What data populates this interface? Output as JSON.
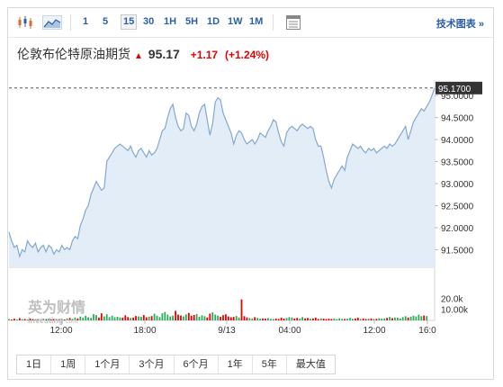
{
  "toolbar": {
    "candle_icon": "candlestick-icon",
    "area_icon": "area-chart-icon",
    "intervals": [
      "1",
      "5",
      "15",
      "30",
      "1H",
      "5H",
      "1D",
      "1W",
      "1M"
    ],
    "active_interval": "15",
    "table_icon": "table-icon",
    "tech_chart_link": "技术图表 »"
  },
  "header": {
    "name": "伦敦布伦特原油期货",
    "price": "95.17",
    "change": "+1.17",
    "change_pct": "(+1.24%)"
  },
  "colors": {
    "up": "#e60000",
    "down": "#2eaa5b",
    "line": "#84a8cf",
    "fill": "#e3edf7",
    "link": "#2a5ea8"
  },
  "chart_data": {
    "type": "area",
    "y_ticks": [
      "95.0000",
      "94.5000",
      "94.0000",
      "93.5000",
      "93.0000",
      "92.5000",
      "92.0000",
      "91.5000"
    ],
    "ylim": [
      91.1,
      95.35
    ],
    "current_label": "95.1700",
    "x_ticks": [
      "12:00",
      "18:00",
      "9/13",
      "04:00",
      "12:00",
      "16:0"
    ],
    "prices": [
      91.9,
      91.7,
      91.55,
      91.6,
      91.35,
      91.5,
      91.45,
      91.7,
      91.6,
      91.55,
      91.65,
      91.45,
      91.55,
      91.6,
      91.45,
      91.6,
      91.55,
      91.4,
      91.5,
      91.45,
      91.6,
      91.5,
      91.55,
      91.5,
      91.7,
      91.8,
      91.75,
      92.05,
      92.2,
      92.4,
      92.5,
      92.75,
      92.9,
      93.05,
      92.95,
      92.85,
      92.9,
      93.5,
      93.6,
      93.7,
      93.8,
      93.85,
      93.9,
      93.85,
      93.8,
      93.75,
      93.85,
      93.7,
      93.6,
      93.75,
      93.8,
      93.7,
      93.6,
      93.75,
      93.65,
      93.7,
      93.8,
      94.0,
      94.2,
      94.25,
      94.5,
      94.7,
      94.8,
      94.5,
      94.3,
      94.2,
      94.25,
      94.6,
      94.55,
      94.3,
      94.2,
      94.35,
      94.6,
      94.75,
      94.8,
      94.45,
      94.1,
      94.35,
      94.85,
      94.95,
      94.9,
      94.6,
      94.45,
      94.3,
      94.15,
      93.9,
      94.1,
      94.2,
      94.15,
      94.0,
      93.9,
      93.95,
      94.0,
      93.9,
      94.0,
      94.15,
      94.1,
      94.05,
      94.2,
      94.3,
      94.45,
      94.4,
      94.15,
      93.95,
      93.85,
      94.15,
      94.25,
      94.3,
      94.25,
      94.2,
      94.3,
      94.35,
      94.3,
      94.25,
      94.3,
      94.25,
      94.0,
      93.85,
      93.85,
      93.6,
      93.3,
      93.05,
      92.9,
      93.1,
      93.2,
      93.3,
      93.4,
      93.3,
      93.6,
      93.75,
      93.9,
      93.85,
      93.8,
      93.85,
      93.75,
      93.7,
      93.8,
      93.75,
      93.8,
      93.7,
      93.75,
      93.8,
      93.85,
      93.8,
      93.9,
      93.85,
      93.9,
      94.0,
      94.1,
      94.2,
      94.3,
      94.0,
      94.2,
      94.4,
      94.5,
      94.6,
      94.7,
      94.65,
      94.75,
      94.85,
      95.0,
      95.17
    ],
    "volume_ticks": [
      "20.0k",
      "10.00k"
    ],
    "volume_max": 30000,
    "volumes": [
      1200,
      800,
      1500,
      900,
      2000,
      1100,
      1300,
      900,
      1700,
      1000,
      800,
      1200,
      900,
      1500,
      1100,
      1600,
      900,
      1300,
      1000,
      1200,
      1500,
      900,
      1800,
      2200,
      1400,
      2600,
      1800,
      3400,
      2400,
      4200,
      2800,
      2200,
      5600,
      4800,
      2600,
      6400,
      3600,
      5400,
      3000,
      4200,
      2900,
      3300,
      2600,
      2400,
      4600,
      3000,
      2200,
      2600,
      4000,
      3600,
      3200,
      4800,
      2800,
      3400,
      3900,
      6000,
      4200,
      3000,
      6400,
      7600,
      5200,
      3600,
      4300,
      8600,
      5200,
      4400,
      3600,
      5400,
      6700,
      4200,
      4900,
      5800,
      3300,
      4600,
      3800,
      2700,
      6100,
      7200,
      5200,
      4300,
      3300,
      4700,
      5400,
      3600,
      2800,
      3100,
      4000,
      2600,
      19000,
      3800,
      2700,
      2200,
      1700,
      2900,
      2200,
      1500,
      1800,
      1600,
      2000,
      1400,
      1200,
      1700,
      1300,
      2400,
      1600,
      2100,
      2900,
      2600,
      1800,
      2300,
      1700,
      2900,
      1800,
      2200,
      1500,
      1700,
      2400,
      1300,
      1900,
      1600,
      1200,
      1500,
      1300,
      1700,
      1100,
      1900,
      1400,
      1300,
      1600,
      2300,
      1400,
      1800,
      2500,
      1400,
      1800,
      1200,
      1500,
      1800,
      1300,
      1400,
      2000,
      1600,
      1800,
      2300,
      3100,
      2000,
      2600,
      2400,
      1800,
      2900,
      3800,
      2600,
      3300,
      4200,
      3600,
      5100,
      3800,
      4400,
      3900
    ]
  },
  "watermark": {
    "logo_cn": "英为财情",
    "logo_en": "Investing",
    "logo_suffix": ".com"
  },
  "ranges": [
    "1日",
    "1周",
    "1个月",
    "3个月",
    "6个月",
    "1年",
    "5年",
    "最大值"
  ]
}
